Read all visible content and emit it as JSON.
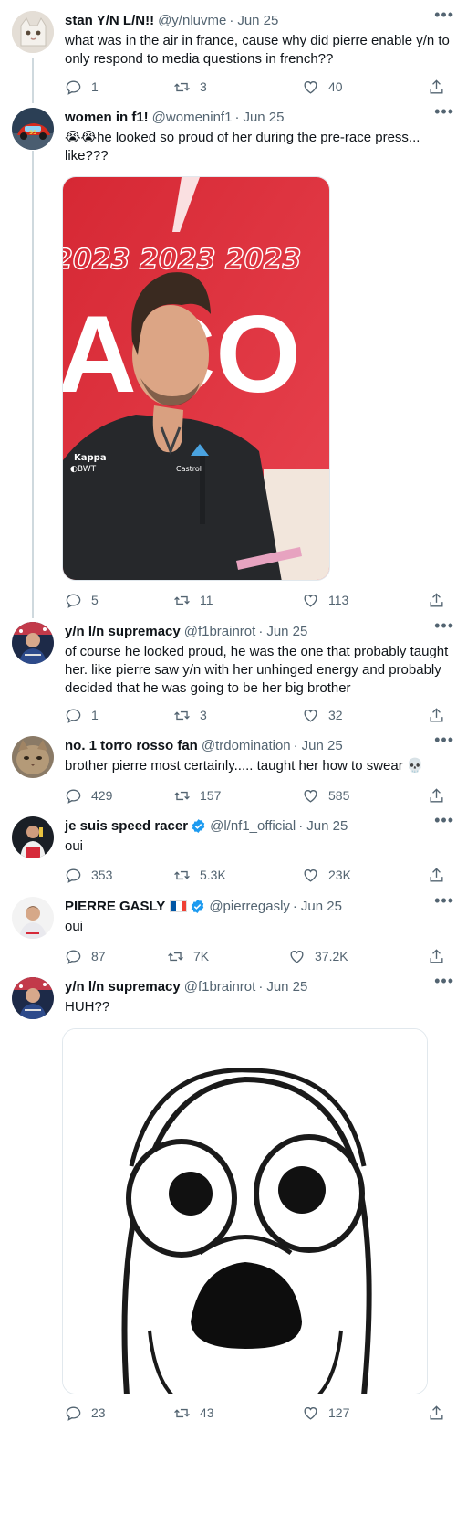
{
  "tweets": [
    {
      "name": "stan Y/N L/N!!",
      "handle": "@y/nluvme",
      "date": "Jun 25",
      "text": "what was in the air in france, cause why did pierre enable y/n to only respond to media questions in french??",
      "replies": "1",
      "retweets": "3",
      "likes": "40",
      "avatar_icon": "cat-icon"
    },
    {
      "name": "women in f1!",
      "handle": "@womeninf1",
      "date": "Jun 25",
      "text_emoji": "😭😭",
      "text": "he looked so proud of her during the pre-race press... like???",
      "media": {
        "banner": "2023 2023 2023",
        "big": "ACO"
      },
      "replies": "5",
      "retweets": "11",
      "likes": "113",
      "avatar_icon": "race-car-icon"
    },
    {
      "name": "y/n l/n supremacy",
      "handle": "@f1brainrot",
      "date": "Jun 25",
      "text": "of course he looked proud, he was the one that probably taught her. like pierre saw y/n with her unhinged energy and probably decided that he was going to be her big brother",
      "replies": "1",
      "retweets": "3",
      "likes": "32",
      "avatar_icon": "driver-photo-icon"
    },
    {
      "name": "no. 1 torro rosso fan",
      "handle": "@trdomination",
      "date": "Jun 25",
      "text": "brother pierre most certainly..... taught her how to swear",
      "text_emoji": "💀",
      "replies": "429",
      "retweets": "157",
      "likes": "585",
      "avatar_icon": "cat-photo-icon"
    },
    {
      "name": "je suis speed racer",
      "handle": "@l/nf1_official",
      "date": "Jun 25",
      "text": "oui",
      "replies": "353",
      "retweets": "5.3K",
      "likes": "23K",
      "avatar_icon": "podium-photo-icon"
    },
    {
      "name": "PIERRE GASLY",
      "handle": "@pierregasly",
      "date": "Jun 25",
      "text": "oui",
      "replies": "87",
      "retweets": "7K",
      "likes": "37.2K",
      "avatar_icon": "driver-portrait-icon"
    },
    {
      "name": "y/n l/n supremacy",
      "handle": "@f1brainrot",
      "date": "Jun 25",
      "text": "HUH??",
      "replies": "23",
      "retweets": "43",
      "likes": "127",
      "avatar_icon": "driver-photo-icon"
    }
  ],
  "colors": {
    "text": "#0f1419",
    "muted": "#536471",
    "verified": "#1d9bf0",
    "thread_line": "#cfd9de"
  },
  "icons": {
    "more": "more-dots-icon",
    "reply": "reply-icon",
    "retweet": "retweet-icon",
    "like": "heart-icon",
    "share": "share-icon",
    "verified": "verified-badge-icon",
    "flag": "france-flag-icon"
  }
}
